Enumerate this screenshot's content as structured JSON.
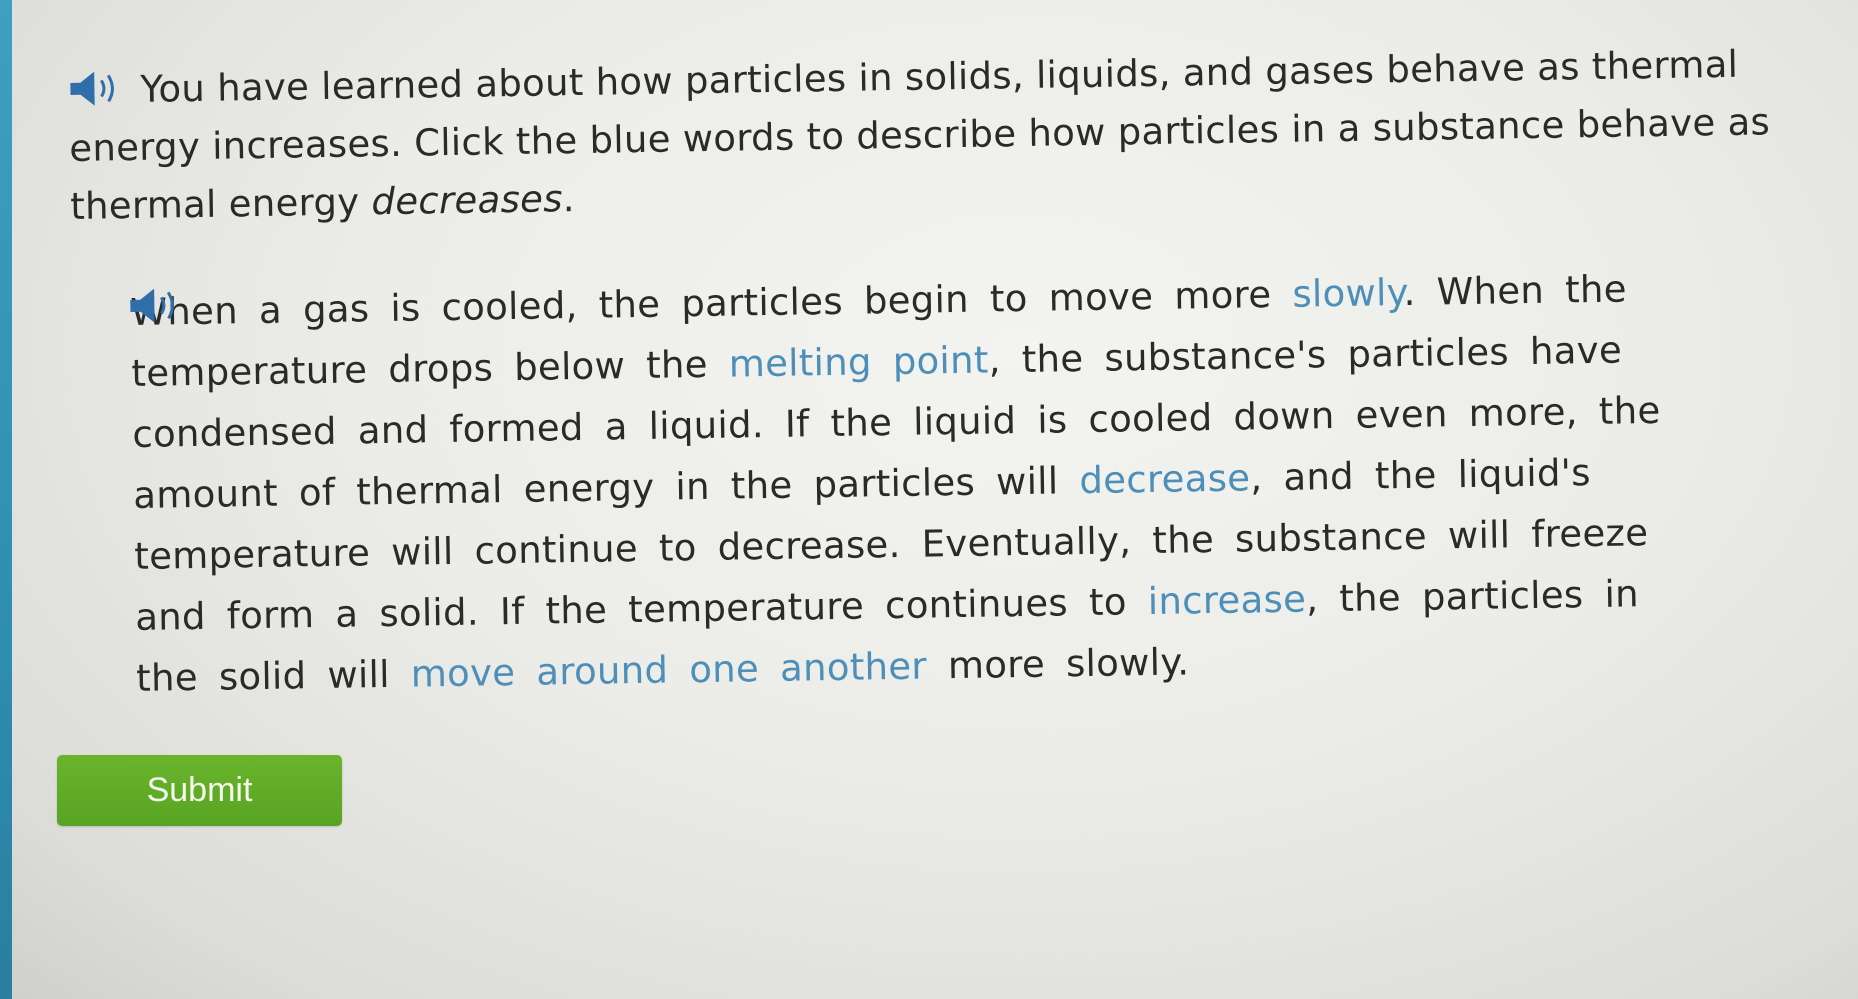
{
  "intro": {
    "line1": "You have learned about how particles in solids, liquids, and gases behave as thermal",
    "line2": "energy increases. Click the blue words to describe how particles in a substance behave as",
    "line3_prefix": "thermal energy ",
    "line3_emph": "decreases",
    "line3_suffix": "."
  },
  "passage": {
    "l1_a": "When a gas is cooled, the particles begin to move more ",
    "choice_1": "slowly",
    "l1_b": ". When the",
    "l2_a": "temperature drops below the ",
    "choice_2": "melting point",
    "l2_b": ", the substance's particles have",
    "l3": "condensed and formed a liquid. If the liquid is cooled down even more, the",
    "l4_a": "amount of thermal energy in the particles will ",
    "choice_3": "decrease",
    "l4_b": ", and the liquid's",
    "l5": "temperature will continue to decrease. Eventually, the substance will freeze",
    "l6_a": "and form a solid. If the temperature continues to ",
    "choice_4": "increase",
    "l6_b": ", the particles in",
    "l7_a": "the solid will ",
    "choice_5": "move around one another",
    "l7_b": " more slowly."
  },
  "submit_label": "Submit",
  "colors": {
    "accent_blue": "#4d8fb8",
    "speaker_blue": "#2f6ea8",
    "submit_green": "#5fab26",
    "left_strip": "#3a98bb"
  },
  "icons": {
    "audio": "speaker-icon"
  }
}
